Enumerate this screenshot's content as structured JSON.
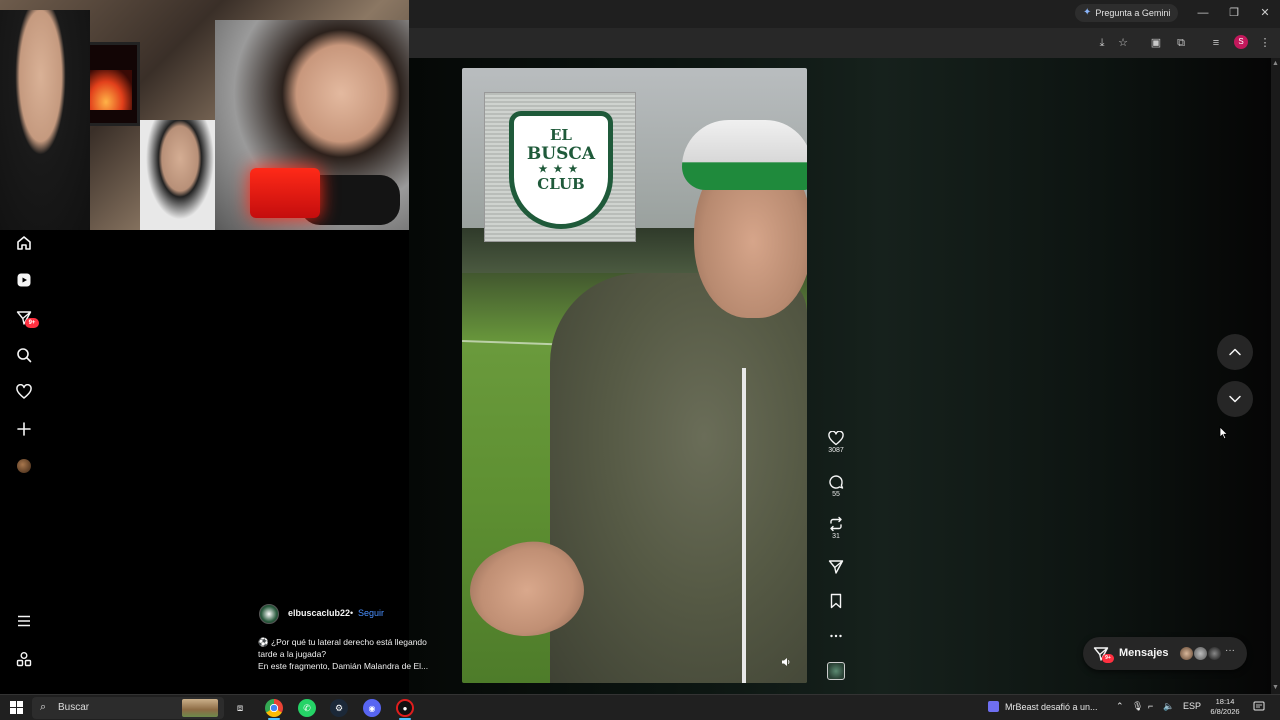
{
  "browser": {
    "gemini_label": "Pregunta a Gemini",
    "profile_initial": "S",
    "window_controls": [
      "—",
      "❐",
      "✕"
    ]
  },
  "nav": {
    "items": [
      {
        "name": "home",
        "icon": "home-icon"
      },
      {
        "name": "reels",
        "icon": "reels-icon"
      },
      {
        "name": "messages",
        "icon": "send-icon",
        "badge": "9+"
      },
      {
        "name": "search",
        "icon": "search-icon"
      },
      {
        "name": "notifications",
        "icon": "heart-icon"
      },
      {
        "name": "create",
        "icon": "plus-icon"
      },
      {
        "name": "profile",
        "icon": "avatar"
      },
      {
        "name": "more",
        "icon": "menu-icon"
      },
      {
        "name": "also-from-meta",
        "icon": "meta-icon"
      }
    ]
  },
  "reel": {
    "logo_text": {
      "line1": "EL",
      "line2": "BUSCA",
      "stars": "★★★",
      "line3": "CLUB"
    },
    "likes": "3087",
    "comments": "55",
    "reposts": "31",
    "author": "elbuscaclub22",
    "separator": "•",
    "follow_label": "Seguir",
    "caption_lines": [
      "⚽ ¿Por qué tu lateral derecho está llegando",
      "tarde a la jugada?",
      "En este fragmento, Damián Malandra de El..."
    ]
  },
  "messages": {
    "label": "Mensajes",
    "badge": "9+"
  },
  "taskbar": {
    "search_placeholder": "Buscar",
    "news_text": "MrBeast desafió a un...",
    "lang": "ESP",
    "time": "18:14",
    "date": "6/8/2026"
  },
  "colors": {
    "accent_blue": "#4a90ff",
    "badge_red": "#ff3040",
    "bg": "#000000"
  }
}
